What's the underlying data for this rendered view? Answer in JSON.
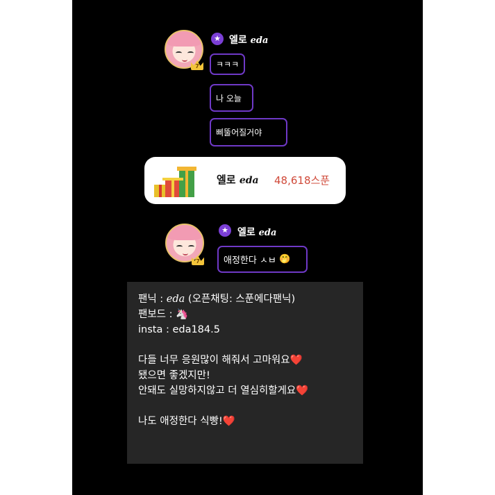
{
  "chat": {
    "first": {
      "username": "엘로",
      "username_script": "eda",
      "badge_icon": "star",
      "level": "7",
      "messages": [
        "ㅋㅋㅋ",
        "나 오늘",
        "삐뚤어질거야"
      ]
    },
    "gift": {
      "username": "엘로",
      "username_script": "eda",
      "amount": "48,618스푼"
    },
    "second": {
      "username": "엘로",
      "username_script": "eda",
      "badge_icon": "star",
      "level": "7",
      "message": "애정한다 ㅅㅂ",
      "emoji": "🤭"
    }
  },
  "caption": {
    "l1_prefix": "팬닉 : ",
    "l1_script": "eda",
    "l1_suffix": " (오픈채팅: 스푼에다팬닉)",
    "l2_prefix": "팬보드 : ",
    "l2_emoji": "🦄",
    "l3": "insta : eda184.5",
    "l4": "다들 너무 응원많이 해줘서 고마워요",
    "l5": "됐으면 좋겠지만!",
    "l6": "안돼도 실망하지않고 더 열심히할게요",
    "l7": "나도 애정한다 식빵!",
    "heart": "❤️"
  }
}
